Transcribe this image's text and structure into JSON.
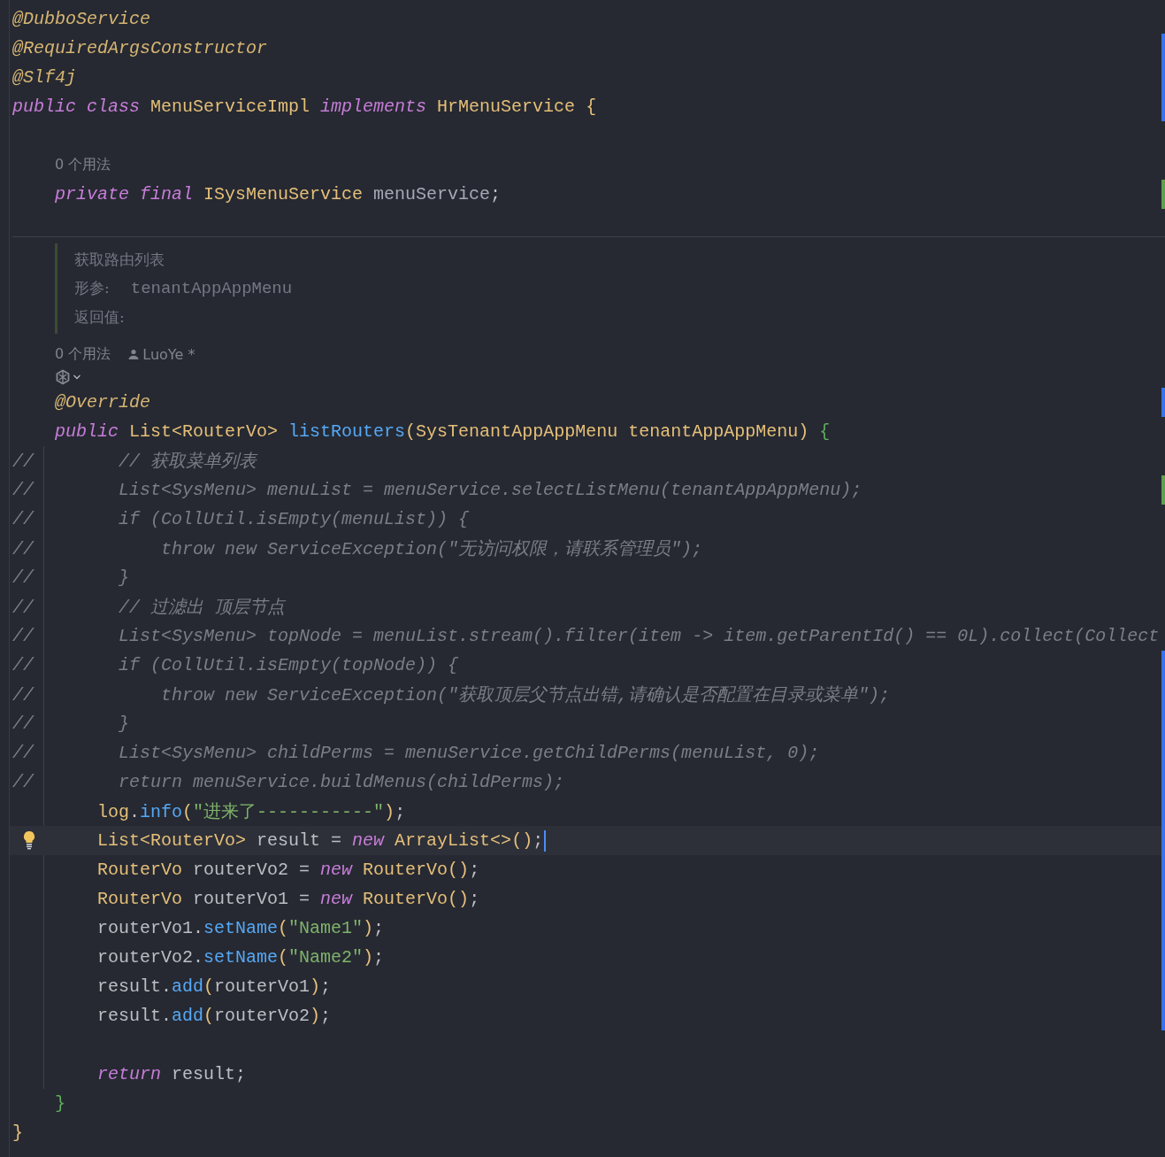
{
  "editor": {
    "lines": [
      {
        "kind": "code",
        "tokens": [
          {
            "text": "@DubboService",
            "kind": "ann"
          }
        ]
      },
      {
        "kind": "code",
        "modified": true,
        "tokens": [
          {
            "text": "@RequiredArgsConstructor",
            "kind": "ann"
          }
        ]
      },
      {
        "kind": "code",
        "modified": true,
        "tokens": [
          {
            "text": "@Slf4j",
            "kind": "ann"
          }
        ]
      },
      {
        "kind": "code",
        "modified": true,
        "tokens": [
          {
            "text": "public ",
            "kind": "kw"
          },
          {
            "text": "class ",
            "kind": "kw"
          },
          {
            "text": "MenuServiceImpl ",
            "kind": "type"
          },
          {
            "text": "implements ",
            "kind": "kw"
          },
          {
            "text": "HrMenuService ",
            "kind": "type"
          },
          {
            "text": "{",
            "kind": "paren"
          }
        ]
      },
      {
        "kind": "blank"
      },
      {
        "kind": "hint",
        "text": "0 个用法"
      },
      {
        "kind": "code",
        "added": true,
        "tokens": [
          {
            "text": "    private ",
            "kind": "kw"
          },
          {
            "text": "final ",
            "kind": "kw"
          },
          {
            "text": "ISysMenuService ",
            "kind": "type"
          },
          {
            "text": "menuService",
            "kind": "field"
          },
          {
            "text": ";",
            "kind": "plain"
          }
        ]
      },
      {
        "kind": "doc",
        "summary": "获取路由列表",
        "params_label": "形参:",
        "param": "tenantAppAppMenu",
        "returns_label": "返回值:"
      },
      {
        "kind": "usage",
        "text": "0 个用法",
        "author": "LuoYe *"
      },
      {
        "kind": "inlay_actions"
      },
      {
        "kind": "code",
        "modified": true,
        "tokens": [
          {
            "text": "    @Override",
            "kind": "ann"
          }
        ]
      },
      {
        "kind": "code",
        "tokens": [
          {
            "text": "    public ",
            "kind": "kw"
          },
          {
            "text": "List<RouterVo> ",
            "kind": "type"
          },
          {
            "text": "listRouters",
            "kind": "fn"
          },
          {
            "text": "(",
            "kind": "paren"
          },
          {
            "text": "SysTenantAppAppMenu tenantAppAppMenu",
            "kind": "type"
          },
          {
            "text": ")",
            "kind": "paren"
          },
          {
            "text": " {",
            "kind": "brace"
          }
        ]
      },
      {
        "kind": "block",
        "children": [
          {
            "kind": "commented",
            "text": "//        // 获取菜单列表"
          },
          {
            "kind": "commented",
            "added": true,
            "text": "//        List<SysMenu> menuList = menuService.selectListMenu(tenantAppAppMenu);"
          },
          {
            "kind": "commented",
            "text": "//        if (CollUtil.isEmpty(menuList)) {"
          },
          {
            "kind": "commented",
            "text": "//            throw new ServiceException(\"无访问权限，请联系管理员\");"
          },
          {
            "kind": "commented",
            "text": "//        }"
          },
          {
            "kind": "commented",
            "text": "//        // 过滤出 顶层节点"
          },
          {
            "kind": "commented",
            "text": "//        List<SysMenu> topNode = menuList.stream().filter(item -> item.getParentId() == 0L).collect(Collect"
          },
          {
            "kind": "commented",
            "modified": true,
            "text": "//        if (CollUtil.isEmpty(topNode)) {"
          },
          {
            "kind": "commented",
            "modified": true,
            "text": "//            throw new ServiceException(\"获取顶层父节点出错,请确认是否配置在目录或菜单\");"
          },
          {
            "kind": "commented",
            "modified": true,
            "text": "//        }"
          },
          {
            "kind": "commented",
            "modified": true,
            "text": "//        List<SysMenu> childPerms = menuService.getChildPerms(menuList, 0);"
          },
          {
            "kind": "commented",
            "modified": true,
            "text": "//        return menuService.buildMenus(childPerms);"
          },
          {
            "kind": "code",
            "modified": true,
            "tokens": [
              {
                "text": "        log",
                "kind": "type"
              },
              {
                "text": ".",
                "kind": "plain"
              },
              {
                "text": "info",
                "kind": "fn"
              },
              {
                "text": "(",
                "kind": "paren"
              },
              {
                "text": "\"进来了-----------\"",
                "kind": "str"
              },
              {
                "text": ")",
                "kind": "paren"
              },
              {
                "text": ";",
                "kind": "plain"
              }
            ]
          },
          {
            "kind": "code",
            "modified": true,
            "current": true,
            "tokens": [
              {
                "text": "        List<RouterVo> ",
                "kind": "type"
              },
              {
                "text": "result = ",
                "kind": "plain"
              },
              {
                "text": "new ",
                "kind": "kw"
              },
              {
                "text": "ArrayList<>",
                "kind": "type"
              },
              {
                "text": "()",
                "kind": "paren"
              },
              {
                "text": ";",
                "kind": "plain"
              }
            ]
          },
          {
            "kind": "code",
            "modified": true,
            "tokens": [
              {
                "text": "        RouterVo ",
                "kind": "type"
              },
              {
                "text": "routerVo2 = ",
                "kind": "plain"
              },
              {
                "text": "new ",
                "kind": "kw"
              },
              {
                "text": "RouterVo",
                "kind": "type"
              },
              {
                "text": "()",
                "kind": "paren"
              },
              {
                "text": ";",
                "kind": "plain"
              }
            ]
          },
          {
            "kind": "code",
            "modified": true,
            "tokens": [
              {
                "text": "        RouterVo ",
                "kind": "type"
              },
              {
                "text": "routerVo1 = ",
                "kind": "plain"
              },
              {
                "text": "new ",
                "kind": "kw"
              },
              {
                "text": "RouterVo",
                "kind": "type"
              },
              {
                "text": "()",
                "kind": "paren"
              },
              {
                "text": ";",
                "kind": "plain"
              }
            ]
          },
          {
            "kind": "code",
            "modified": true,
            "tokens": [
              {
                "text": "        routerVo1.",
                "kind": "plain"
              },
              {
                "text": "setName",
                "kind": "fn"
              },
              {
                "text": "(",
                "kind": "paren"
              },
              {
                "text": "\"Name1\"",
                "kind": "str"
              },
              {
                "text": ")",
                "kind": "paren"
              },
              {
                "text": ";",
                "kind": "plain"
              }
            ]
          },
          {
            "kind": "code",
            "modified": true,
            "tokens": [
              {
                "text": "        routerVo2.",
                "kind": "plain"
              },
              {
                "text": "setName",
                "kind": "fn"
              },
              {
                "text": "(",
                "kind": "paren"
              },
              {
                "text": "\"Name2\"",
                "kind": "str"
              },
              {
                "text": ")",
                "kind": "paren"
              },
              {
                "text": ";",
                "kind": "plain"
              }
            ]
          },
          {
            "kind": "code",
            "modified": true,
            "tokens": [
              {
                "text": "        result.",
                "kind": "plain"
              },
              {
                "text": "add",
                "kind": "fn"
              },
              {
                "text": "(",
                "kind": "paren"
              },
              {
                "text": "routerVo1",
                "kind": "plain"
              },
              {
                "text": ")",
                "kind": "paren"
              },
              {
                "text": ";",
                "kind": "plain"
              }
            ]
          },
          {
            "kind": "code",
            "modified": true,
            "tokens": [
              {
                "text": "        result.",
                "kind": "plain"
              },
              {
                "text": "add",
                "kind": "fn"
              },
              {
                "text": "(",
                "kind": "paren"
              },
              {
                "text": "routerVo2",
                "kind": "plain"
              },
              {
                "text": ")",
                "kind": "paren"
              },
              {
                "text": ";",
                "kind": "plain"
              }
            ]
          },
          {
            "kind": "blank"
          },
          {
            "kind": "code",
            "tokens": [
              {
                "text": "        return ",
                "kind": "kw"
              },
              {
                "text": "result;",
                "kind": "plain"
              }
            ]
          }
        ]
      },
      {
        "kind": "code",
        "tokens": [
          {
            "text": "    }",
            "kind": "brace"
          }
        ]
      },
      {
        "kind": "code",
        "tokens": [
          {
            "text": "}",
            "kind": "paren"
          }
        ]
      }
    ]
  }
}
